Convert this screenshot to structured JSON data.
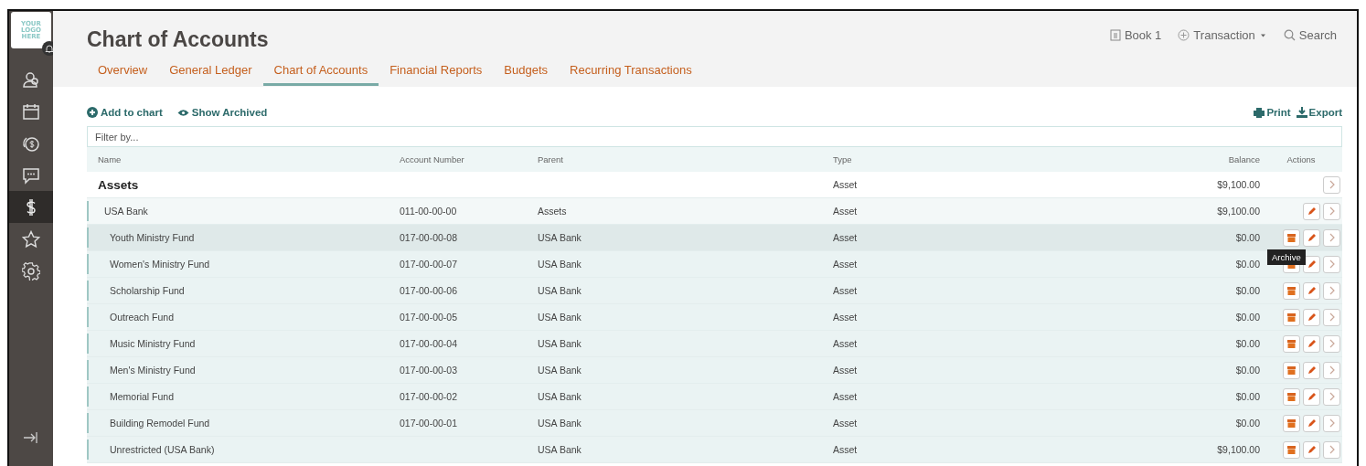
{
  "logo": {
    "lines": [
      "YOUR",
      "LOGO",
      "HERE"
    ]
  },
  "sidebar": {
    "items": [
      {
        "selected": false
      },
      {
        "selected": false
      },
      {
        "selected": false
      },
      {
        "selected": false
      },
      {
        "selected": true
      },
      {
        "selected": false
      },
      {
        "selected": false
      }
    ]
  },
  "header": {
    "title": "Chart of Accounts",
    "book": "Book 1",
    "transaction": "Transaction",
    "search": "Search"
  },
  "tabs": [
    {
      "label": "Overview",
      "selected": false
    },
    {
      "label": "General Ledger",
      "selected": false
    },
    {
      "label": "Chart of Accounts",
      "selected": true
    },
    {
      "label": "Financial Reports",
      "selected": false
    },
    {
      "label": "Budgets",
      "selected": false
    },
    {
      "label": "Recurring Transactions",
      "selected": false
    }
  ],
  "toolbar": {
    "add": "Add to chart",
    "archived": "Show Archived",
    "print": "Print",
    "export": "Export"
  },
  "filter": {
    "placeholder": "Filter by..."
  },
  "table": {
    "columns": [
      "Name",
      "Account Number",
      "Parent",
      "Type",
      "Balance",
      "Actions"
    ],
    "rows": [
      {
        "kind": "group",
        "name": "Assets",
        "type": "Asset",
        "balance": "$9,100.00",
        "can_edit": false,
        "can_archive": false,
        "hovered": false
      },
      {
        "kind": "account",
        "name": "USA Bank",
        "number": "011-00-00-00",
        "parent": "Assets",
        "type": "Asset",
        "balance": "$9,100.00",
        "can_edit": true,
        "can_archive": false,
        "hovered": false
      },
      {
        "kind": "subaccount",
        "name": "Youth Ministry Fund",
        "number": "017-00-00-08",
        "parent": "USA Bank",
        "type": "Asset",
        "balance": "$0.00",
        "can_edit": true,
        "can_archive": true,
        "hovered": true,
        "tooltip": "Archive"
      },
      {
        "kind": "subaccount",
        "name": "Women's Ministry Fund",
        "number": "017-00-00-07",
        "parent": "USA Bank",
        "type": "Asset",
        "balance": "$0.00",
        "can_edit": true,
        "can_archive": true,
        "hovered": false
      },
      {
        "kind": "subaccount",
        "name": "Scholarship Fund",
        "number": "017-00-00-06",
        "parent": "USA Bank",
        "type": "Asset",
        "balance": "$0.00",
        "can_edit": true,
        "can_archive": true,
        "hovered": false
      },
      {
        "kind": "subaccount",
        "name": "Outreach Fund",
        "number": "017-00-00-05",
        "parent": "USA Bank",
        "type": "Asset",
        "balance": "$0.00",
        "can_edit": true,
        "can_archive": true,
        "hovered": false
      },
      {
        "kind": "subaccount",
        "name": "Music Ministry Fund",
        "number": "017-00-00-04",
        "parent": "USA Bank",
        "type": "Asset",
        "balance": "$0.00",
        "can_edit": true,
        "can_archive": true,
        "hovered": false
      },
      {
        "kind": "subaccount",
        "name": "Men's Ministry Fund",
        "number": "017-00-00-03",
        "parent": "USA Bank",
        "type": "Asset",
        "balance": "$0.00",
        "can_edit": true,
        "can_archive": true,
        "hovered": false
      },
      {
        "kind": "subaccount",
        "name": "Memorial Fund",
        "number": "017-00-00-02",
        "parent": "USA Bank",
        "type": "Asset",
        "balance": "$0.00",
        "can_edit": true,
        "can_archive": true,
        "hovered": false
      },
      {
        "kind": "subaccount",
        "name": "Building Remodel Fund",
        "number": "017-00-00-01",
        "parent": "USA Bank",
        "type": "Asset",
        "balance": "$0.00",
        "can_edit": true,
        "can_archive": true,
        "hovered": false
      },
      {
        "kind": "subaccount",
        "name": "Unrestricted (USA Bank)",
        "parent": "USA Bank",
        "type": "Asset",
        "balance": "$9,100.00",
        "can_edit": true,
        "can_archive": true,
        "hovered": false
      }
    ]
  }
}
